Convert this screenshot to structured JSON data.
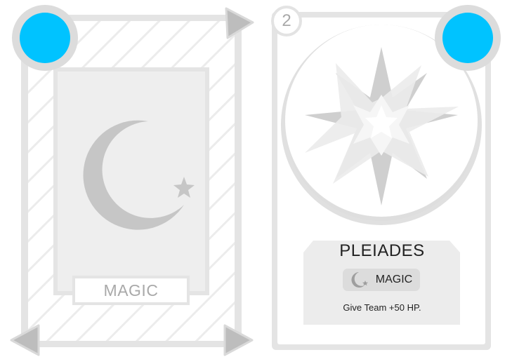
{
  "cards": [
    {
      "face": "back",
      "type_label": "MAGIC",
      "icon": "crescent-star-icon",
      "mana_color": "#00c3ff"
    },
    {
      "face": "front",
      "number": "2",
      "name": "PLEIADES",
      "art_icon": "eight-point-star-icon",
      "type_icon": "crescent-star-icon",
      "type_label": "MAGIC",
      "effect": "Give Team +50 HP.",
      "mana_color": "#00c3ff"
    }
  ],
  "navigation": {
    "arrows": [
      "arrow-top-right-icon",
      "arrow-bottom-left-icon",
      "arrow-bottom-right-icon"
    ]
  },
  "colors": {
    "frame": "#e4e4e4",
    "panel": "#ececec",
    "art": "#c6c6c6",
    "accent": "#00c3ff"
  }
}
